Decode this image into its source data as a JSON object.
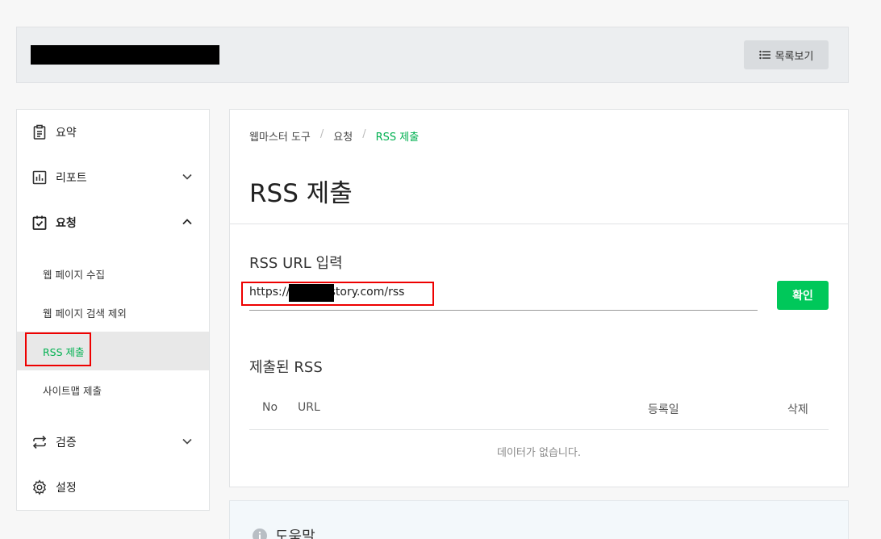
{
  "header": {
    "list_button_label": "목록보기"
  },
  "sidebar": {
    "items": [
      {
        "label": "요약",
        "icon": "clipboard-icon"
      },
      {
        "label": "리포트",
        "icon": "bar-chart-icon"
      },
      {
        "label": "요청",
        "icon": "clipboard-check-icon"
      },
      {
        "label": "검증",
        "icon": "repeat-icon"
      },
      {
        "label": "설정",
        "icon": "gear-icon"
      }
    ],
    "sub_items": [
      {
        "label": "웹 페이지 수집"
      },
      {
        "label": "웹 페이지 검색 제외"
      },
      {
        "label": "RSS 제출"
      },
      {
        "label": "사이트맵 제출"
      }
    ]
  },
  "main": {
    "breadcrumb": [
      "웹마스터 도구",
      "요청",
      "RSS 제출"
    ],
    "title": "RSS 제출",
    "url_section_title": "RSS URL 입력",
    "url_value": "https://        .tistory.com/rss",
    "confirm_label": "확인",
    "submitted_title": "제출된 RSS",
    "table_headers": [
      "No",
      "URL",
      "등록일",
      "삭제"
    ],
    "empty_text": "데이터가 없습니다."
  },
  "help": {
    "label": "도움말"
  },
  "colors": {
    "accent": "#00c85a",
    "active_text": "#00b050",
    "highlight_border": "#e00000"
  }
}
